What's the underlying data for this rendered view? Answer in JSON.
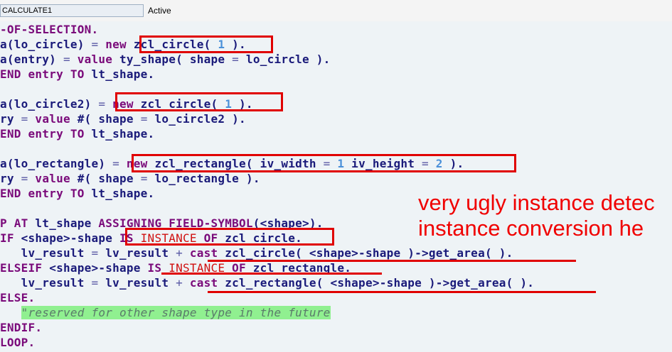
{
  "window": {
    "program_name": "CALCULATE1",
    "status": "Active"
  },
  "code_lines": [
    [
      {
        "t": "-OF-SELECTION.",
        "c": "kw"
      }
    ],
    [
      {
        "t": "a(lo_circle) ",
        "c": ""
      },
      {
        "t": "=",
        "c": "op"
      },
      {
        "t": " new ",
        "c": "kw"
      },
      {
        "t": "zcl_circle( ",
        "c": ""
      },
      {
        "t": "1",
        "c": "num"
      },
      {
        "t": " ).",
        "c": ""
      }
    ],
    [
      {
        "t": "a(entry) ",
        "c": ""
      },
      {
        "t": "=",
        "c": "op"
      },
      {
        "t": " value ",
        "c": "kw"
      },
      {
        "t": "ty_shape( shape ",
        "c": ""
      },
      {
        "t": "=",
        "c": "op"
      },
      {
        "t": " lo_circle ).",
        "c": ""
      }
    ],
    [
      {
        "t": "END entry TO ",
        "c": "kw"
      },
      {
        "t": "lt_shape.",
        "c": ""
      }
    ],
    [],
    [
      {
        "t": "a(lo_circle2) ",
        "c": ""
      },
      {
        "t": "=",
        "c": "op"
      },
      {
        "t": " new ",
        "c": "kw"
      },
      {
        "t": "zcl_circle( ",
        "c": ""
      },
      {
        "t": "1",
        "c": "num"
      },
      {
        "t": " ).",
        "c": ""
      }
    ],
    [
      {
        "t": "ry ",
        "c": ""
      },
      {
        "t": "=",
        "c": "op"
      },
      {
        "t": " value ",
        "c": "kw"
      },
      {
        "t": "#( shape ",
        "c": ""
      },
      {
        "t": "=",
        "c": "op"
      },
      {
        "t": " lo_circle2 ).",
        "c": ""
      }
    ],
    [
      {
        "t": "END entry TO ",
        "c": "kw"
      },
      {
        "t": "lt_shape.",
        "c": ""
      }
    ],
    [],
    [
      {
        "t": "a(lo_rectangle) ",
        "c": ""
      },
      {
        "t": "=",
        "c": "op"
      },
      {
        "t": " new ",
        "c": "kw"
      },
      {
        "t": "zcl_rectangle( iv_width ",
        "c": ""
      },
      {
        "t": "=",
        "c": "op"
      },
      {
        "t": " ",
        "c": ""
      },
      {
        "t": "1",
        "c": "num"
      },
      {
        "t": " iv_height ",
        "c": ""
      },
      {
        "t": "=",
        "c": "op"
      },
      {
        "t": " ",
        "c": ""
      },
      {
        "t": "2",
        "c": "num"
      },
      {
        "t": " ).",
        "c": ""
      }
    ],
    [
      {
        "t": "ry ",
        "c": ""
      },
      {
        "t": "=",
        "c": "op"
      },
      {
        "t": " value ",
        "c": "kw"
      },
      {
        "t": "#( shape ",
        "c": ""
      },
      {
        "t": "=",
        "c": "op"
      },
      {
        "t": " lo_rectangle ).",
        "c": ""
      }
    ],
    [
      {
        "t": "END entry TO ",
        "c": "kw"
      },
      {
        "t": "lt_shape.",
        "c": ""
      }
    ],
    [],
    [
      {
        "t": "P AT ",
        "c": "kw"
      },
      {
        "t": "lt_shape ",
        "c": ""
      },
      {
        "t": "ASSIGNING FIELD-SYMBOL",
        "c": "kw"
      },
      {
        "t": "(<shape>).",
        "c": ""
      }
    ],
    [
      {
        "t": "IF ",
        "c": "kw"
      },
      {
        "t": "<shape>-shape ",
        "c": ""
      },
      {
        "t": "IS ",
        "c": "kw"
      },
      {
        "t": "INSTANCE",
        "c": "red"
      },
      {
        "t": " OF ",
        "c": "kw"
      },
      {
        "t": "zcl_circle.",
        "c": ""
      }
    ],
    [
      {
        "t": "   lv_result ",
        "c": ""
      },
      {
        "t": "=",
        "c": "op"
      },
      {
        "t": " lv_result ",
        "c": ""
      },
      {
        "t": "+",
        "c": "op"
      },
      {
        "t": " cast ",
        "c": "kw"
      },
      {
        "t": "zcl_circle( <shape>-shape )->get_area( ).",
        "c": ""
      }
    ],
    [
      {
        "t": "ELSEIF ",
        "c": "kw"
      },
      {
        "t": "<shape>-shape ",
        "c": ""
      },
      {
        "t": "IS ",
        "c": "kw"
      },
      {
        "t": "INSTANCE",
        "c": "red"
      },
      {
        "t": " OF ",
        "c": "kw"
      },
      {
        "t": "zcl_rectangle.",
        "c": ""
      }
    ],
    [
      {
        "t": "   lv_result ",
        "c": ""
      },
      {
        "t": "=",
        "c": "op"
      },
      {
        "t": " lv_result ",
        "c": ""
      },
      {
        "t": "+",
        "c": "op"
      },
      {
        "t": " cast ",
        "c": "kw"
      },
      {
        "t": "zcl_rectangle( <shape>-shape )->get_area( ).",
        "c": ""
      }
    ],
    [
      {
        "t": "ELSE.",
        "c": "kw"
      }
    ],
    [
      {
        "t": "   ",
        "c": ""
      },
      {
        "t": "\"reserved for other shape type in the future",
        "c": "cmt"
      }
    ],
    [
      {
        "t": "ENDIF.",
        "c": "kw"
      }
    ],
    [
      {
        "t": "LOOP.",
        "c": "kw"
      }
    ]
  ],
  "annotation": {
    "line1": "very ugly instance detec",
    "line2": "instance conversion he"
  },
  "colors": {
    "highlight": "#e00000",
    "keyword": "#7a0a7a",
    "identifier": "#1a1a7a",
    "number": "#4a90d9",
    "comment_bg": "#90f090"
  }
}
